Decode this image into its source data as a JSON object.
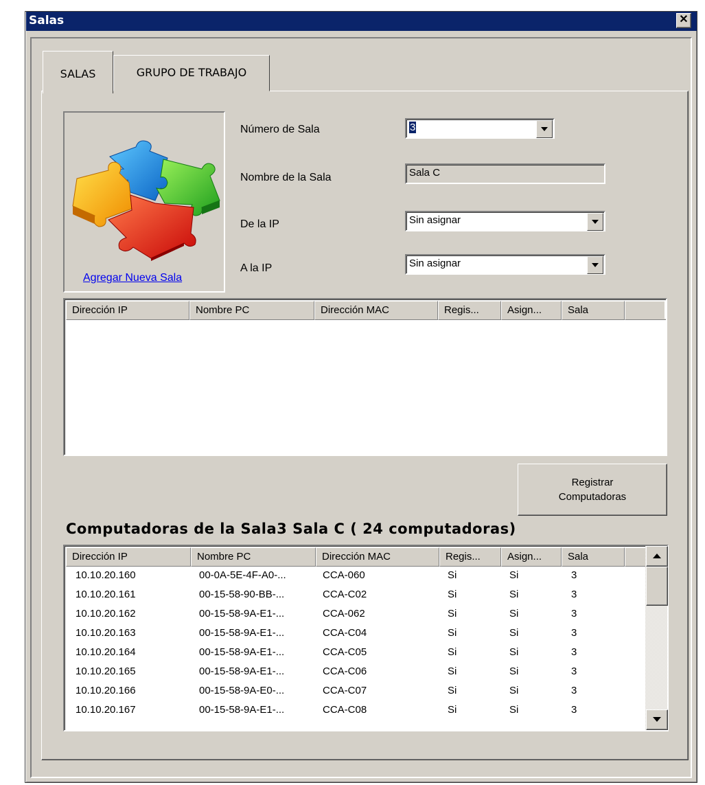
{
  "window": {
    "title": "Salas",
    "close_symbol": "✕"
  },
  "tabs": [
    {
      "label": "SALAS",
      "active": true
    },
    {
      "label": "GRUPO DE TRABAJO",
      "active": false
    }
  ],
  "image_box": {
    "icon": "puzzle-icon",
    "link_label": "Agregar Nueva Sala"
  },
  "form": {
    "numero_label": "Número de Sala",
    "numero_value": "3",
    "nombre_label": "Nombre de la Sala",
    "nombre_value": "Sala C",
    "de_ip_label": "De la IP",
    "de_ip_value": "Sin asignar",
    "a_ip_label": "A la IP",
    "a_ip_value": "Sin asignar"
  },
  "columns": [
    "Dirección IP",
    "Nombre PC",
    "Dirección MAC",
    "Regis...",
    "Asign...",
    "Sala"
  ],
  "register_button": {
    "line1": "Registrar",
    "line2": "Computadoras"
  },
  "computers_heading": "Computadoras de la Sala3 Sala C ( 24 computadoras)",
  "computers": [
    [
      "10.10.20.160",
      "00-0A-5E-4F-A0-...",
      "CCA-060",
      "Si",
      "Si",
      "3"
    ],
    [
      "10.10.20.161",
      "00-15-58-90-BB-...",
      "CCA-C02",
      "Si",
      "Si",
      "3"
    ],
    [
      "10.10.20.162",
      "00-15-58-9A-E1-...",
      "CCA-062",
      "Si",
      "Si",
      "3"
    ],
    [
      "10.10.20.163",
      "00-15-58-9A-E1-...",
      "CCA-C04",
      "Si",
      "Si",
      "3"
    ],
    [
      "10.10.20.164",
      "00-15-58-9A-E1-...",
      "CCA-C05",
      "Si",
      "Si",
      "3"
    ],
    [
      "10.10.20.165",
      "00-15-58-9A-E1-...",
      "CCA-C06",
      "Si",
      "Si",
      "3"
    ],
    [
      "10.10.20.166",
      "00-15-58-9A-E0-...",
      "CCA-C07",
      "Si",
      "Si",
      "3"
    ],
    [
      "10.10.20.167",
      "00-15-58-9A-E1-...",
      "CCA-C08",
      "Si",
      "Si",
      "3"
    ]
  ],
  "colors": {
    "titlebar": "#0a246a",
    "face": "#d4d0c8",
    "link": "#0000ee"
  }
}
